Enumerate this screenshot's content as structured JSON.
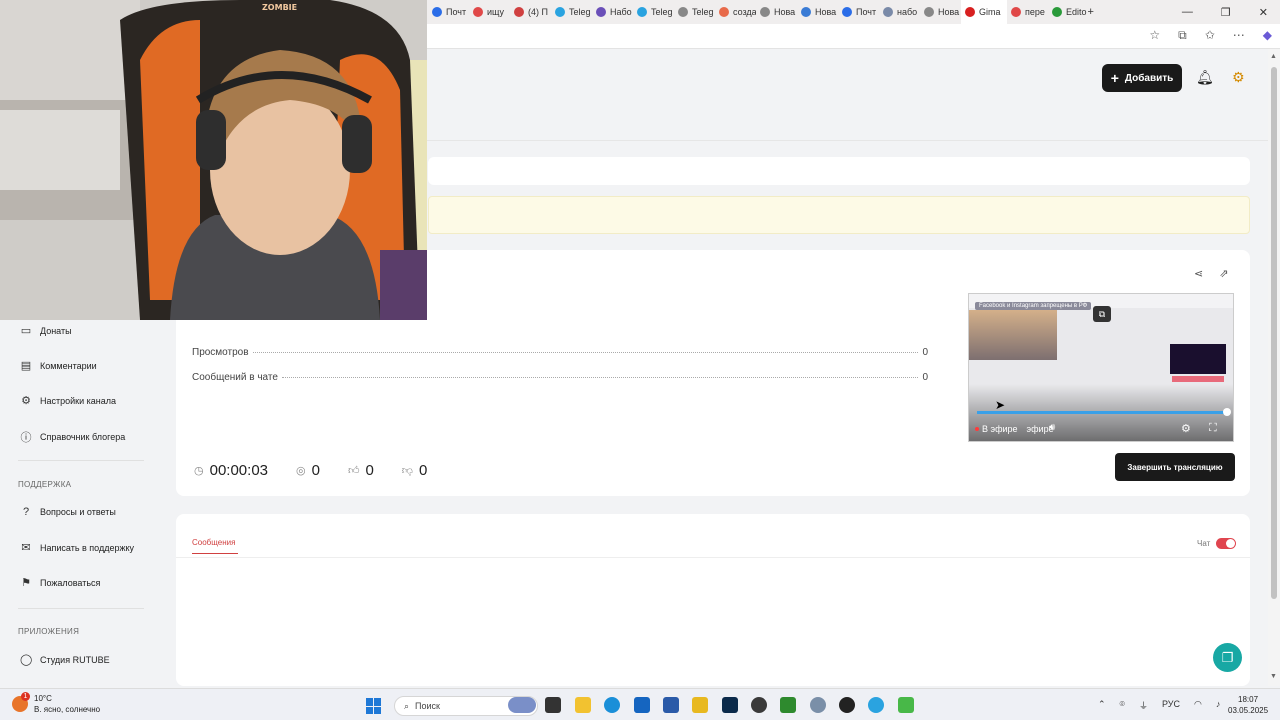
{
  "browser": {
    "tabs": [
      "Почт",
      "ищу",
      "(4) П",
      "Teleg",
      "Набо",
      "Teleg",
      "Teleg",
      "созда",
      "Нова",
      "Нова",
      "Почт",
      "набо",
      "Нова",
      "Gima",
      "пере",
      "Edito"
    ],
    "tab_colors": [
      "#2b6de8",
      "#e04848",
      "#d04040",
      "#2aa3e0",
      "#6a4fb8",
      "#2aa3e0",
      "#888888",
      "#e86a4a",
      "#888888",
      "#3a7bd5",
      "#2b6de8",
      "#7a8aa8",
      "#888888",
      "#d82020",
      "#e04848",
      "#2a9a3a"
    ]
  },
  "header": {
    "add_label": "Добавить"
  },
  "stats": [
    {
      "label": "Просмотров",
      "value": "0"
    },
    {
      "label": "Сообщений в чате",
      "value": "0"
    }
  ],
  "counters": {
    "duration": "00:00:03",
    "viewers": "0",
    "likes": "0",
    "dislikes": "0"
  },
  "player": {
    "title_overlay": "Facebook и Instagram запрещены в РФ",
    "live_label": "В эфире",
    "live_label_2": "эфире",
    "progress": 1.0
  },
  "end_stream_label": "Завершить трансляцию",
  "messages": {
    "tab_label": "Сообщения",
    "chat_label": "Чат"
  },
  "sidebar": {
    "items_top": [
      {
        "label": "Донаты",
        "icon": "wallet-icon"
      },
      {
        "label": "Комментарии",
        "icon": "comment-icon"
      },
      {
        "label": "Настройки канала",
        "icon": "gear-icon"
      },
      {
        "label": "Справочник блогера",
        "icon": "info-icon"
      }
    ],
    "support_heading": "ПОДДЕРЖКА",
    "items_support": [
      {
        "label": "Вопросы и ответы",
        "icon": "question-icon"
      },
      {
        "label": "Написать в поддержку",
        "icon": "mail-icon"
      },
      {
        "label": "Пожаловаться",
        "icon": "flag-icon"
      }
    ],
    "apps_heading": "ПРИЛОЖЕНИЯ",
    "items_apps": [
      {
        "label": "Студия RUTUBE",
        "icon": "studio-icon"
      }
    ]
  },
  "taskbar": {
    "weather_temp": "10°C",
    "weather_desc": "В. ясно, солнечно",
    "weather_badge": "1",
    "search_label": "Поиск",
    "tray_lang": "РУС",
    "time": "18:07",
    "date": "03.05.2025"
  }
}
